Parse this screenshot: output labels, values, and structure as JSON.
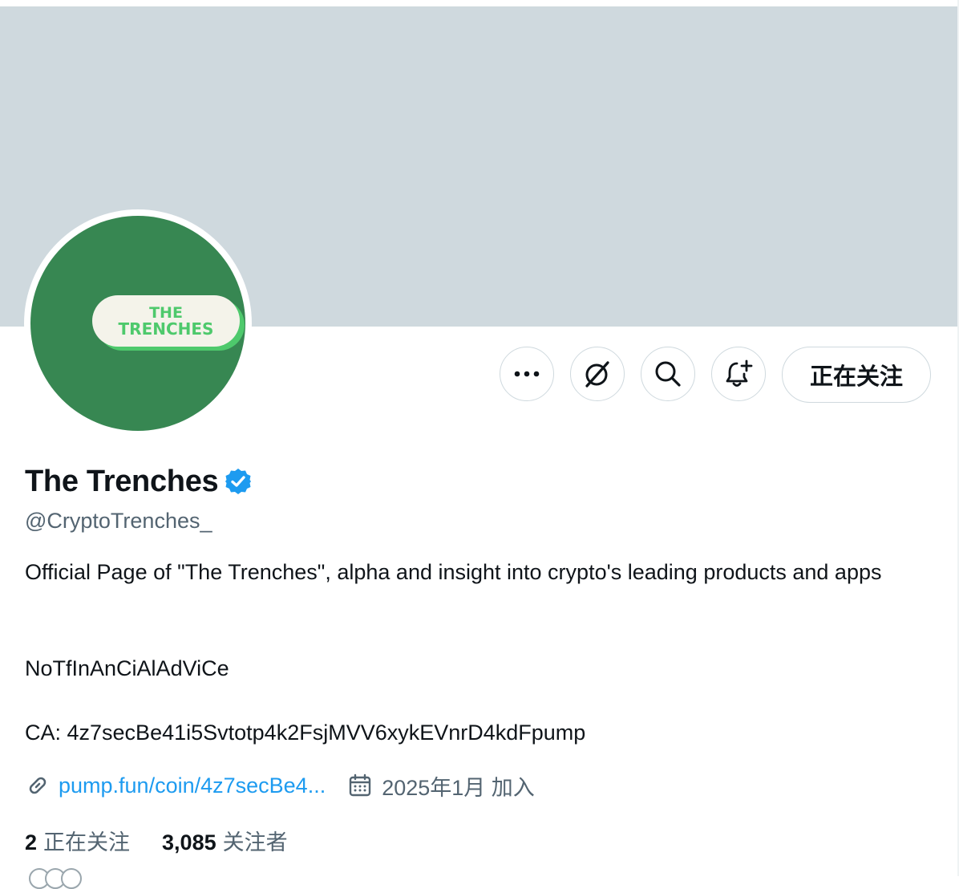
{
  "colors": {
    "banner": "#cfd9de",
    "avatar_bg": "#378752",
    "logo_green": "#4ec96c",
    "logo_pill": "#f4f3ea",
    "link": "#1d9bf0",
    "secondary_text": "#536471",
    "verified": "#1d9bf0"
  },
  "avatar": {
    "logo_line1": "THE",
    "logo_line2": "TRENCHES"
  },
  "actions": {
    "more_icon": "more-dots-icon",
    "grok_icon": "grok-icon",
    "search_icon": "search-icon",
    "notify_icon": "bell-plus-icon",
    "follow_label": "正在关注"
  },
  "profile": {
    "display_name": "The Trenches",
    "verified_icon": "verified-badge-icon",
    "handle": "@CryptoTrenches_",
    "bio_line1": "Official Page of \"The Trenches\", alpha and insight into crypto's leading products and apps",
    "bio_line3": "NoTfInAnCiAlAdViCe",
    "bio_line4": "CA: 4z7secBe41i5Svtotp4k2FsjMVV6xykEVnrD4kdFpump",
    "link_icon": "link-icon",
    "link_text": "pump.fun/coin/4z7secBe4...",
    "calendar_icon": "calendar-icon",
    "joined_text": "2025年1月 加入"
  },
  "stats": {
    "following_count": "2",
    "following_label": "正在关注",
    "followers_count": "3,085",
    "followers_label": "关注者"
  }
}
